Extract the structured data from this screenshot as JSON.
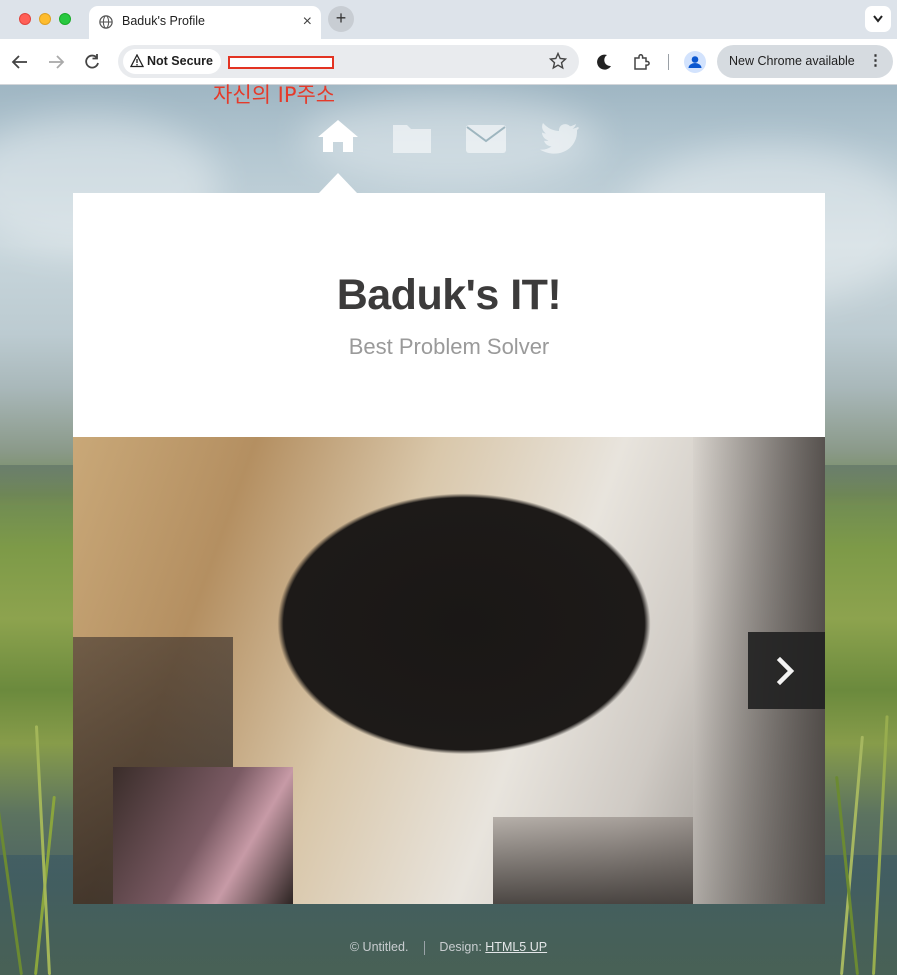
{
  "browser": {
    "tab": {
      "title": "Baduk's Profile",
      "favicon": "globe-icon",
      "close": "×"
    },
    "new_tab": "+",
    "security_chip": {
      "label": "Not Secure",
      "icon": "warning-triangle-icon"
    },
    "url": "",
    "update_pill": {
      "label": "New Chrome available",
      "more": "⋮"
    },
    "colors": {
      "chrome_bg": "#dde3ea",
      "redaction_box": "#e33322"
    }
  },
  "annotation": {
    "text": "자신의 IP주소",
    "color": "#e53a2a"
  },
  "site": {
    "nav": [
      {
        "name": "home",
        "icon": "home-icon",
        "active": true
      },
      {
        "name": "portfolio",
        "icon": "folder-icon",
        "active": false
      },
      {
        "name": "contact",
        "icon": "envelope-icon",
        "active": false
      },
      {
        "name": "twitter",
        "icon": "twitter-icon",
        "active": false
      }
    ],
    "title": "Baduk's IT!",
    "subtitle": "Best Problem Solver",
    "slider": {
      "image": "dog-closeup-photo",
      "next_icon": "chevron-right-icon"
    },
    "footer": {
      "copyright": "© Untitled.",
      "design_label": "Design: ",
      "design_link": "HTML5 UP"
    }
  }
}
